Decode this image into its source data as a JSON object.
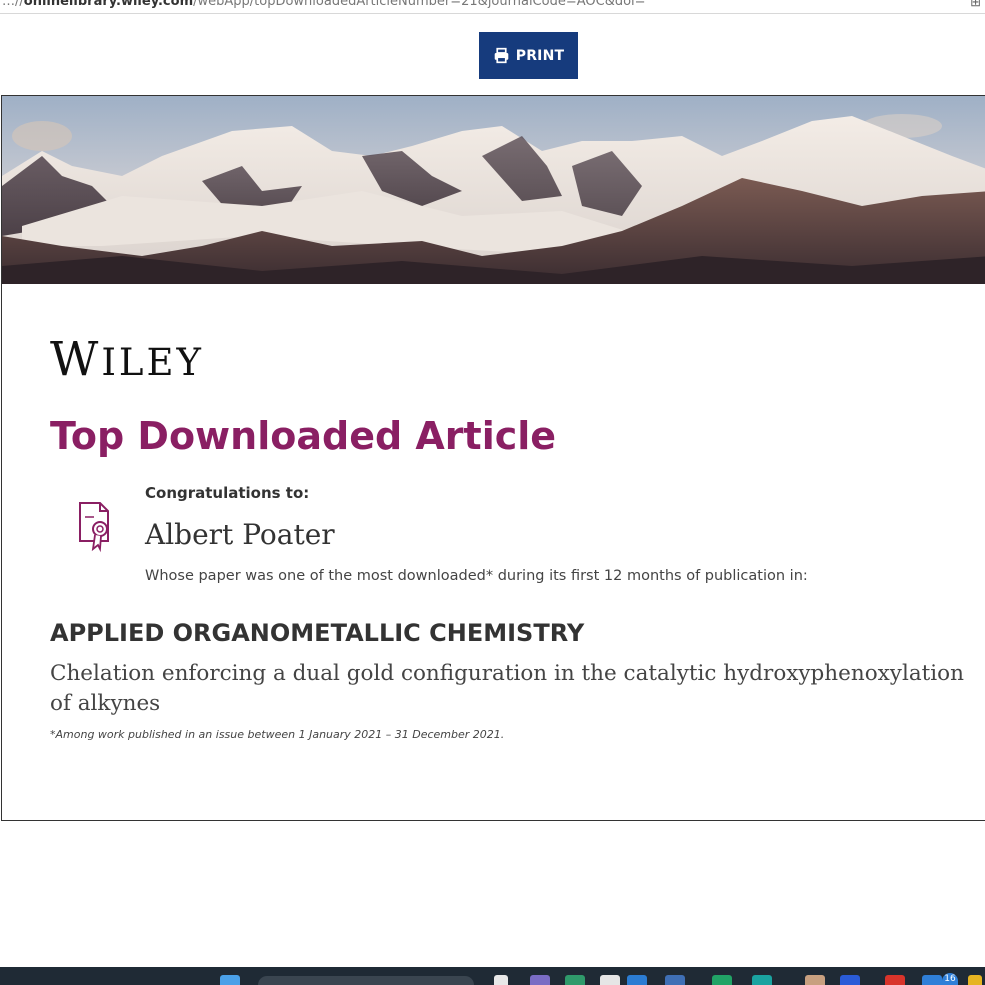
{
  "browser": {
    "url_text": "…//onlinelibrary.wiley.com/webApp/topDownloadedArticleNumber=21&journalCode=AOC&doi=",
    "url_domain": "onlinelibrary.wiley.com"
  },
  "toolbar": {
    "print_label": "PRINT",
    "print_icon": "printer-icon"
  },
  "certificate": {
    "banner_image": "snowy mountain range panorama",
    "logo_text": "WILEY",
    "award_title": "Top Downloaded Article",
    "icon": "certificate-award-icon",
    "congrats_label": "Congratulations to:",
    "author_name": "Albert Poater",
    "description": "Whose paper was one of the most downloaded* during its first 12 months of publication in:",
    "journal_name": "APPLIED ORGANOMETALLIC CHEMISTRY",
    "paper_title": "Chelation enforcing a dual gold configuration in the catalytic hydroxyphenoxylation of alkynes",
    "footnote": "*Among work published in an issue between 1 January 2021 – 31 December 2021."
  },
  "taskbar": {
    "notification_count": "16"
  },
  "colors": {
    "print_button": "#163b7d",
    "award_title": "#8a1f63",
    "icon_stroke": "#8a1f63"
  }
}
